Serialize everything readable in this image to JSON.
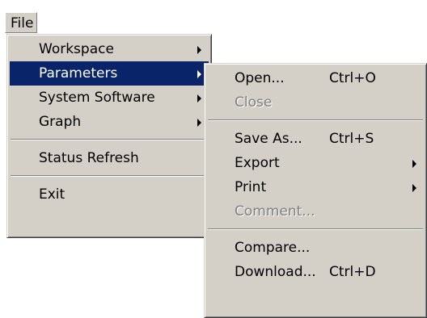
{
  "menubar": {
    "file_label": "File"
  },
  "file_menu": {
    "workspace": "Workspace",
    "parameters": "Parameters",
    "system_software": "System Software",
    "graph": "Graph",
    "status_refresh": "Status Refresh",
    "exit": "Exit"
  },
  "parameters_menu": {
    "open": {
      "label": "Open...",
      "shortcut": "Ctrl+O"
    },
    "close": {
      "label": "Close"
    },
    "save_as": {
      "label": "Save As...",
      "shortcut": "Ctrl+S"
    },
    "export": {
      "label": "Export"
    },
    "print": {
      "label": "Print"
    },
    "comment": {
      "label": "Comment..."
    },
    "compare": {
      "label": "Compare..."
    },
    "download": {
      "label": "Download...",
      "shortcut": "Ctrl+D"
    }
  },
  "colors": {
    "menu_face": "#d4d0c8",
    "highlight": "#0a246a",
    "disabled_text": "#808080"
  }
}
